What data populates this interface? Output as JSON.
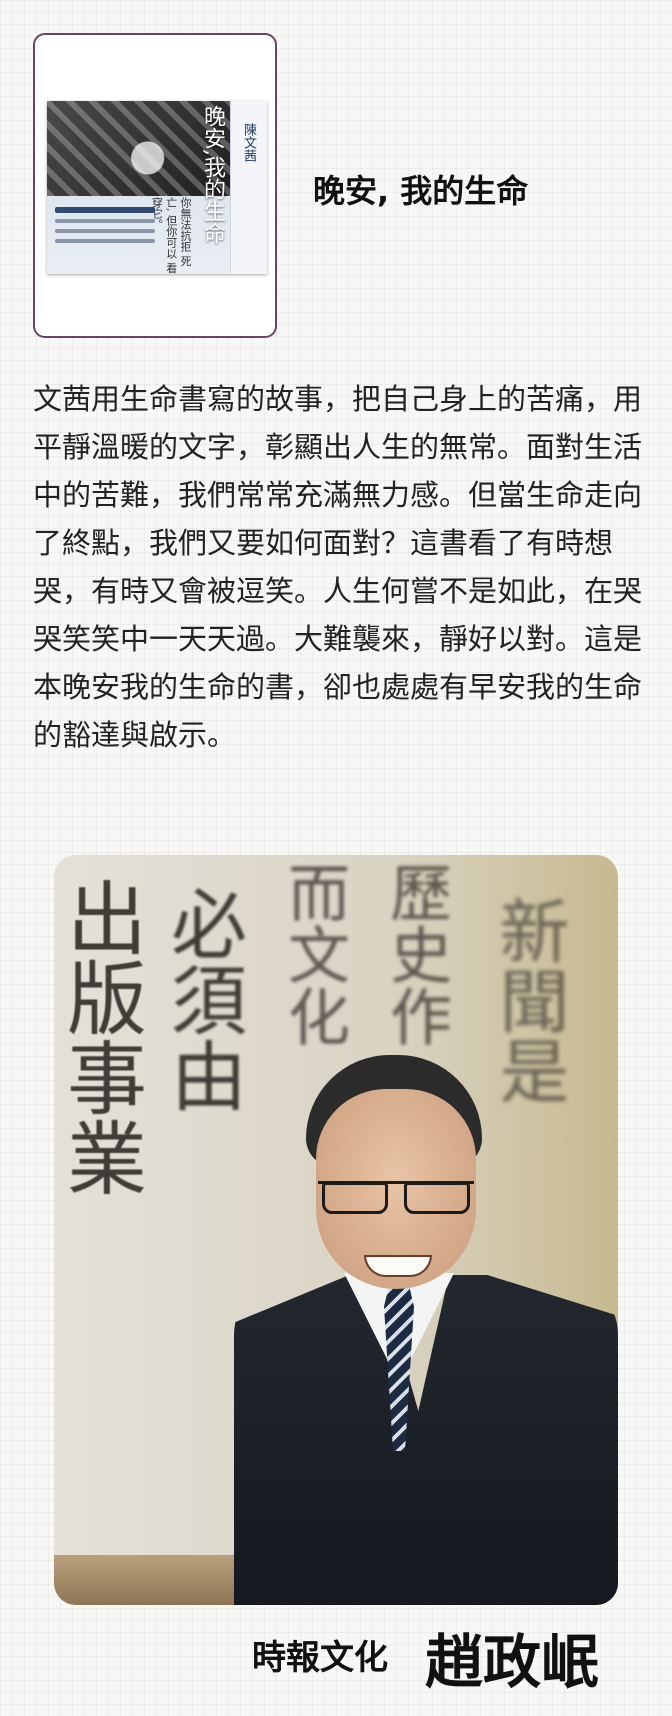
{
  "book": {
    "title": "晚安, 我的生命",
    "cover": {
      "author": "陳文茜",
      "title": "晚安,我的生命",
      "tagline": "你無法抗拒 死亡, 但你可以 看穿它。"
    }
  },
  "description": "文茜用生命書寫的故事，把自己身上的苦痛，用平靜溫暖的文字，彰顯出人生的無常。面對生活中的苦難，我們常常充滿無力感。但當生命走向了終點，我們又要如何面對？這書看了有時想哭，有時又會被逗笑。人生何嘗不是如此，在哭哭笑笑中一天天過。大難襲來，靜好以對。這是本晚安我的生命的書，卻也處處有早安我的生命的豁達與啟示。",
  "portrait": {
    "calligraphy": [
      "出版事業",
      "必須由",
      "而文化",
      "歷史作",
      "新聞是"
    ]
  },
  "footer": {
    "publisher": "時報文化",
    "author": "趙政岷"
  },
  "colors": {
    "card_border": "#6e4368",
    "background": "#f7f7f5",
    "text": "#222222"
  }
}
